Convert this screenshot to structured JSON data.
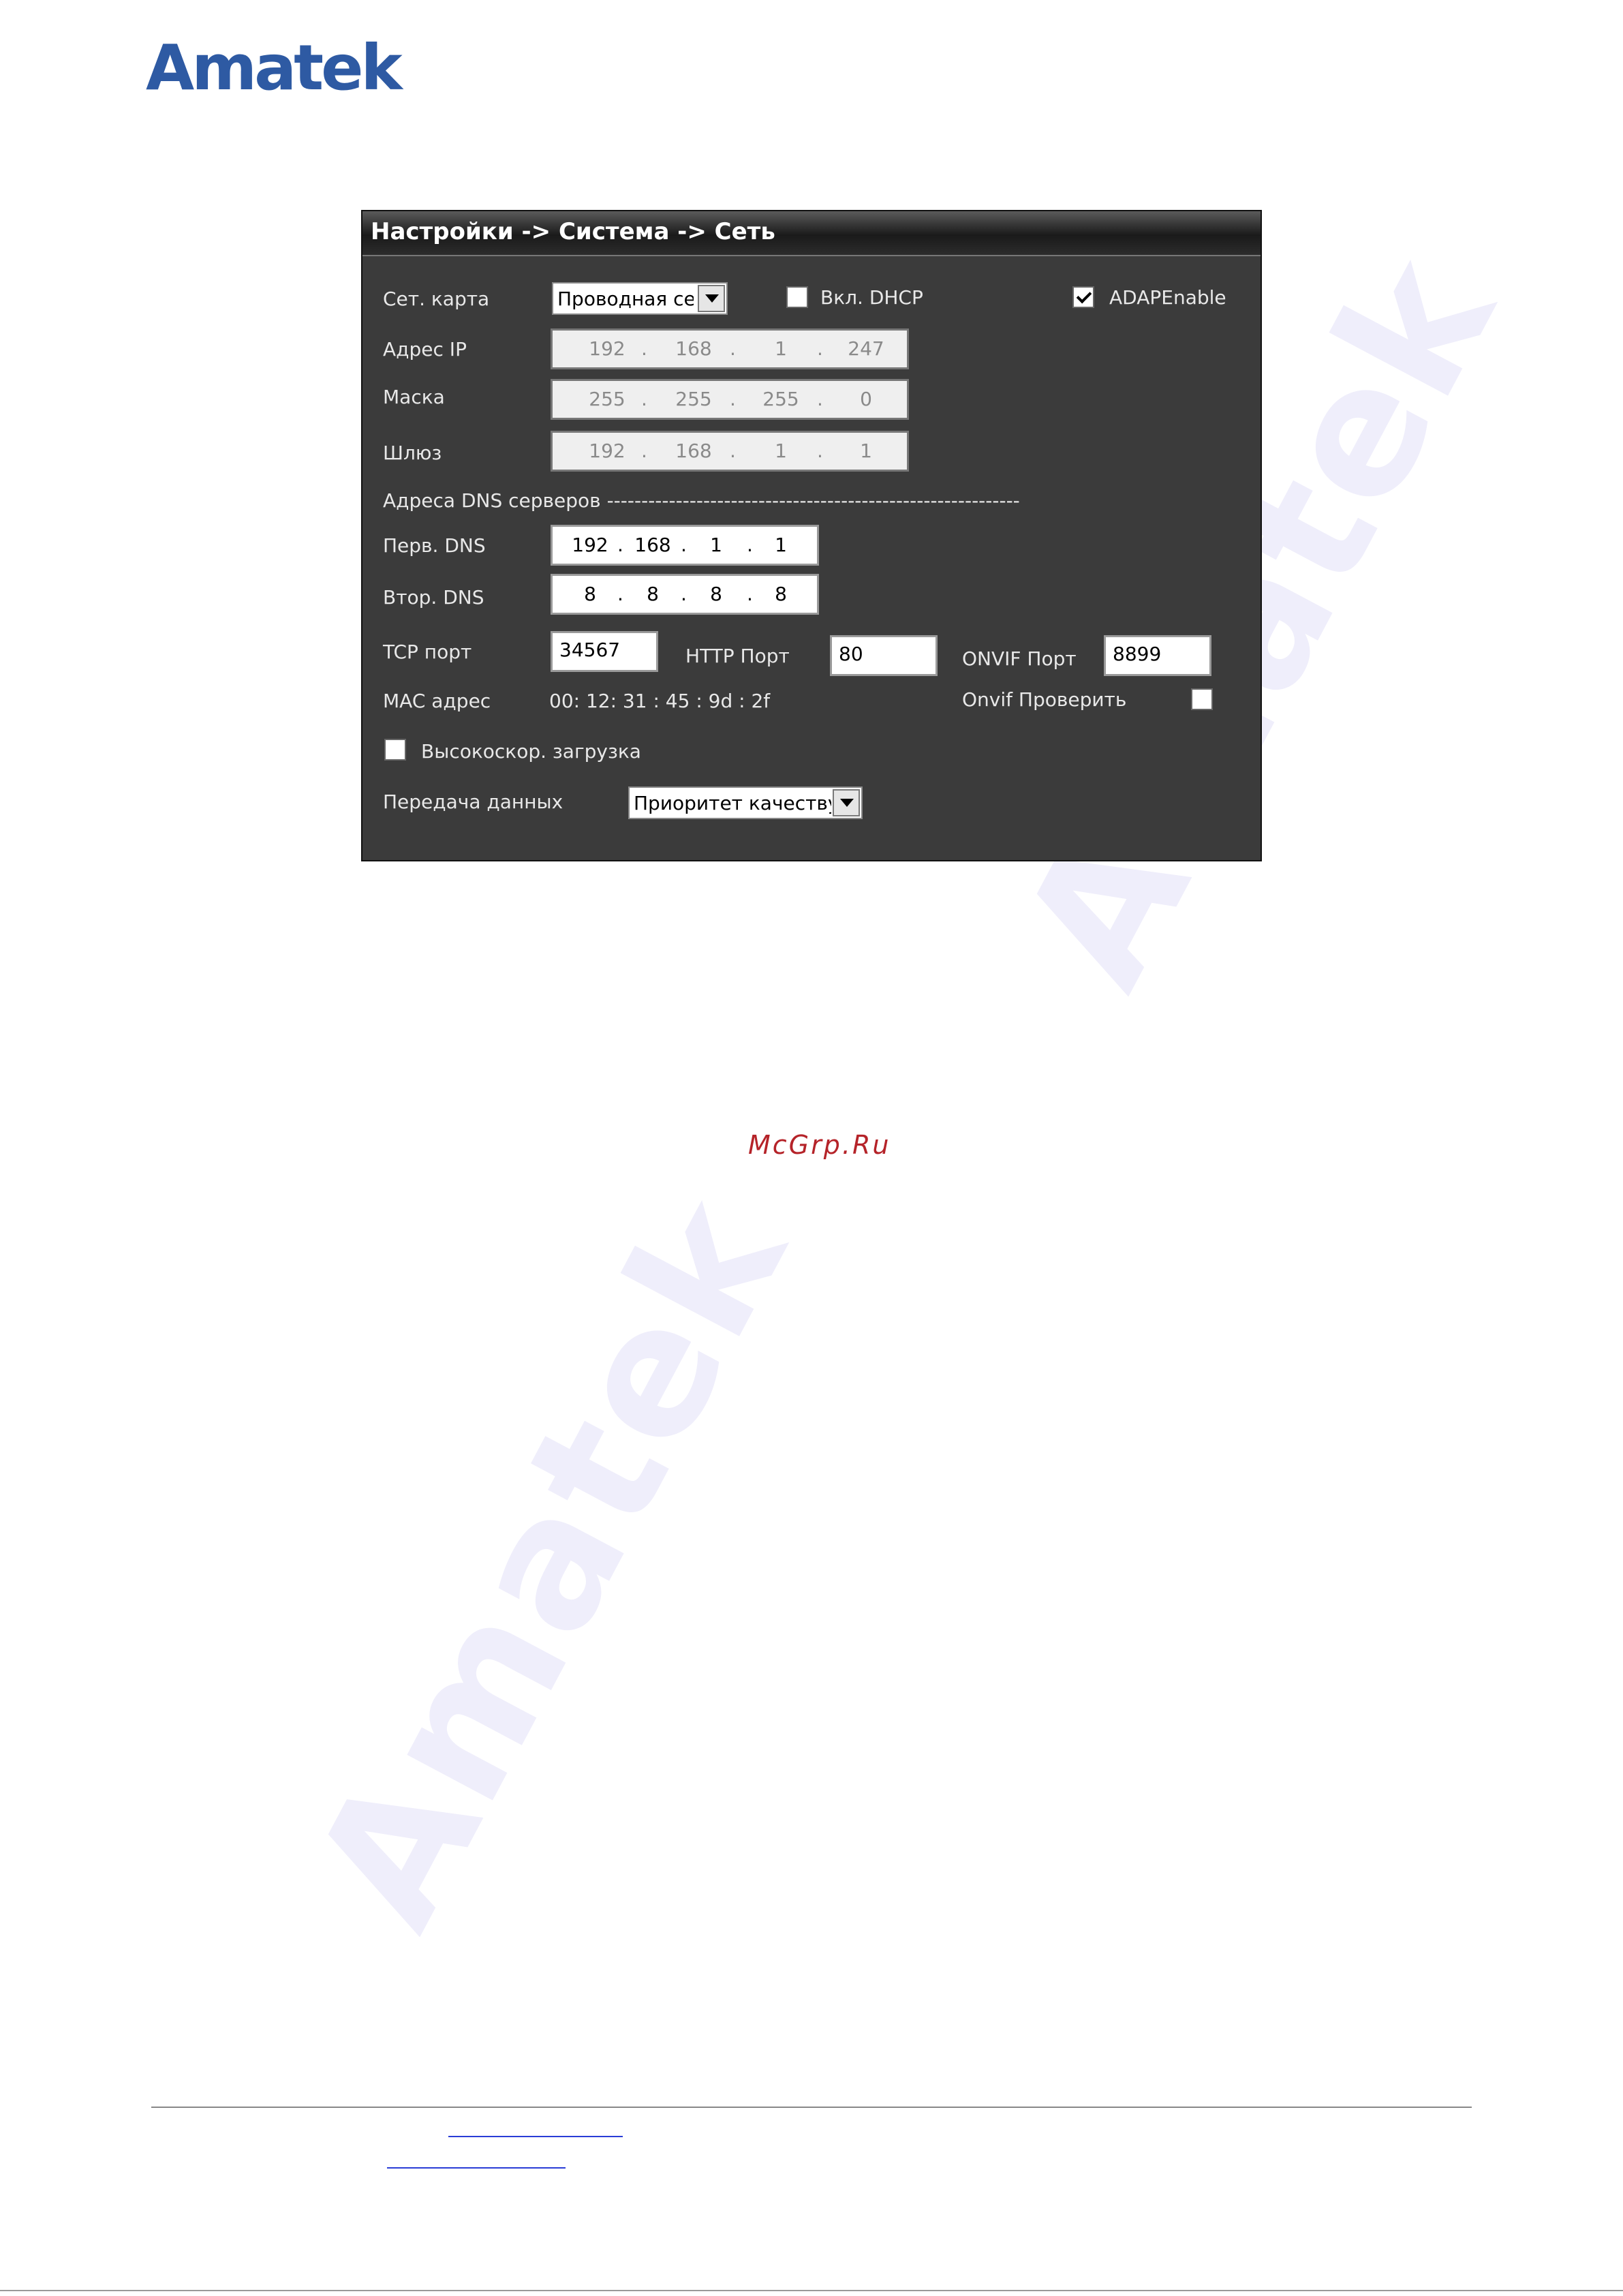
{
  "brand": {
    "logo_text": "Amatek",
    "watermark_text": "Amatek",
    "site_label": "McGrp.Ru",
    "logo_color": "#2e5aa3",
    "site_label_color": "#b52329"
  },
  "window": {
    "title": "Настройки -> Система -> Сеть"
  },
  "network_card": {
    "label": "Сет. карта",
    "value": "Проводная сет"
  },
  "dhcp": {
    "label": "Вкл. DHCP",
    "checked": false
  },
  "adap": {
    "label": "ADAPEnable",
    "checked": true
  },
  "ip": {
    "label": "Адрес IP",
    "octets": [
      "192",
      "168",
      "1",
      "247"
    ]
  },
  "mask": {
    "label": "Маска",
    "octets": [
      "255",
      "255",
      "255",
      "0"
    ]
  },
  "gateway": {
    "label": "Шлюз",
    "octets": [
      "192",
      "168",
      "1",
      "1"
    ]
  },
  "dns_section": {
    "label": "Адреса DNS серверов ------------------------------------------------------------"
  },
  "dns1": {
    "label": "Перв. DNS",
    "octets": [
      "192",
      "168",
      "1",
      "1"
    ]
  },
  "dns2": {
    "label": "Втор. DNS",
    "octets": [
      "8",
      "8",
      "8",
      "8"
    ]
  },
  "separator": ".",
  "tcp": {
    "label": "TCP порт",
    "value": "34567"
  },
  "http": {
    "label": "HTTP Порт",
    "value": "80"
  },
  "onvif": {
    "label": "ONVIF Порт",
    "value": "8899"
  },
  "mac": {
    "label": "MAC адрес",
    "value": "00: 12: 31 : 45 : 9d : 2f"
  },
  "onvif_check": {
    "label": "Onvif Проверить",
    "checked": false
  },
  "high_speed": {
    "label": "Высокоскор. загрузка",
    "checked": false
  },
  "transfer": {
    "label": "Передача данных",
    "value": "Приоритет качеству"
  }
}
